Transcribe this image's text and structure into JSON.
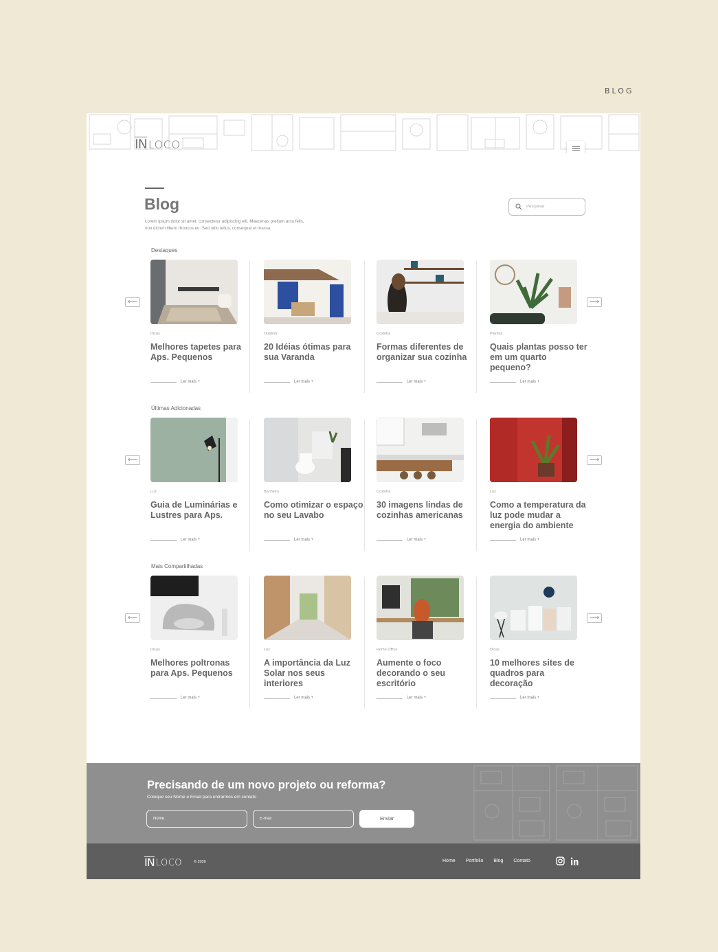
{
  "page_label": "BLOG",
  "header": {
    "logo_mark": "IN",
    "logo_word": "LOCO"
  },
  "blog": {
    "title": "Blog",
    "description": "Lorem ipsum dolor sit amet, consectetur adipiscing elit. Maecenas pretium arcu felis, non dictum libero rhoncus eu. Sed odio tellus, consequat et massa",
    "search_placeholder": "Pesquisar"
  },
  "sections": [
    {
      "title": "Destaques",
      "cards": [
        {
          "category": "Dicas",
          "title": "Melhores tapetes para Aps. Pequenos",
          "more": "Ler mais +"
        },
        {
          "category": "Outdoor",
          "title": "20 Idéias ótimas para sua Varanda",
          "more": "Ler mais +"
        },
        {
          "category": "Cozinha",
          "title": "Formas diferentes de organizar sua cozinha",
          "more": "Ler mais +"
        },
        {
          "category": "Plantas",
          "title": "Quais plantas posso ter em um quarto pequeno?",
          "more": "Ler mais +"
        }
      ]
    },
    {
      "title": "Últimas Adicionadas",
      "cards": [
        {
          "category": "Luz",
          "title": "Guia de Luminárias e Lustres para Aps.",
          "more": "Ler mais +"
        },
        {
          "category": "Banheiro",
          "title": "Como otimizar o espaço no seu Lavabo",
          "more": "Ler mais +"
        },
        {
          "category": "Cozinha",
          "title": "30 imagens lindas de cozinhas americanas",
          "more": "Ler mais +"
        },
        {
          "category": "Luz",
          "title": "Como a temperatura da luz pode mudar a energia do ambiente",
          "more": "Ler mais +"
        }
      ]
    },
    {
      "title": "Mais Compartilhadas",
      "cards": [
        {
          "category": "Dicas",
          "title": "Melhores poltronas para Aps. Pequenos",
          "more": "Ler mais +"
        },
        {
          "category": "Luz",
          "title": "A importância da Luz Solar nos seus interiores",
          "more": "Ler mais +"
        },
        {
          "category": "Home Office",
          "title": "Aumente o foco decorando o seu escritório",
          "more": "Ler mais +"
        },
        {
          "category": "Dicas",
          "title": "10 melhores sites de quadros para decoração",
          "more": "Ler mais +"
        }
      ]
    }
  ],
  "cta": {
    "title": "Precisando de um novo projeto ou reforma?",
    "subtitle": "Coloque seu Nome e Email para entrarmos em contato",
    "name_placeholder": "Nome",
    "email_placeholder": "E-mail",
    "send_label": "Enviar"
  },
  "footer": {
    "logo_mark": "IN",
    "logo_word": "LOCO",
    "copyright": "© 2020",
    "nav": [
      "Home",
      "Portfolio",
      "Blog",
      "Contato"
    ]
  }
}
